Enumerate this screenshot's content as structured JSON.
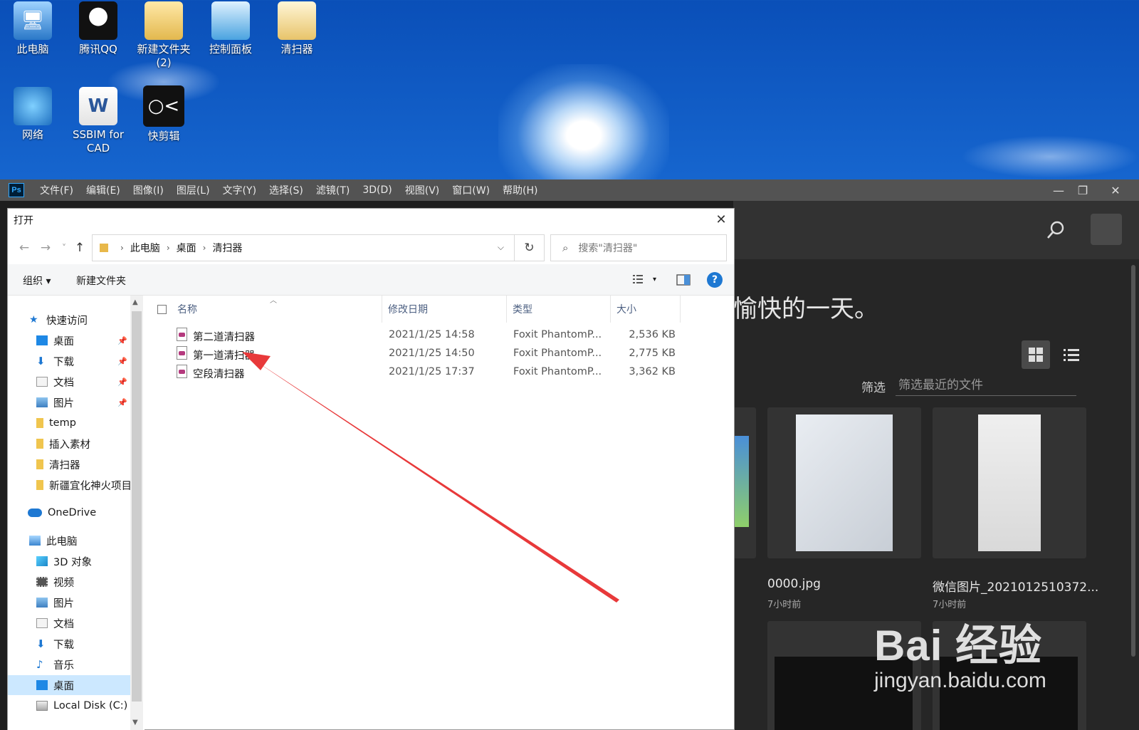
{
  "desktop": {
    "icons": [
      {
        "label": "此电脑",
        "icon": "computer-icon"
      },
      {
        "label": "腾讯QQ",
        "icon": "qq-icon"
      },
      {
        "label": "新建文件夹\n(2)",
        "icon": "folder-icon"
      },
      {
        "label": "控制面板",
        "icon": "control-panel-icon"
      },
      {
        "label": "清扫器",
        "icon": "folder-icon"
      },
      {
        "label": "网络",
        "icon": "network-icon"
      },
      {
        "label": "SSBIM for\nCAD",
        "icon": "word-document-icon"
      },
      {
        "label": "快剪辑",
        "icon": "kuaijianji-app-icon"
      }
    ]
  },
  "photoshop": {
    "logo": "Ps",
    "menus": [
      "文件(F)",
      "编辑(E)",
      "图像(I)",
      "图层(L)",
      "文字(Y)",
      "选择(S)",
      "滤镜(T)",
      "3D(D)",
      "视图(V)",
      "窗口(W)",
      "帮助(H)"
    ],
    "window_controls": {
      "minimize": "—",
      "restore": "❐",
      "close": "✕"
    },
    "home": {
      "greeting": "愉快的一天。",
      "filter_label": "筛选",
      "filter_placeholder": "筛选最近的文件",
      "recent_files": [
        {
          "name": "0000.jpg",
          "time": "7小时前"
        },
        {
          "name": "微信图片_2021012510372...",
          "time": "7小时前"
        }
      ]
    },
    "watermark": {
      "line1": "Bai 经验",
      "line2": "jingyan.baidu.com"
    }
  },
  "dialog": {
    "title": "打开",
    "close": "✕",
    "nav": {
      "back": "←",
      "forward": "→",
      "recent": "˅",
      "up": "↑"
    },
    "breadcrumb": [
      "此电脑",
      "桌面",
      "清扫器"
    ],
    "refresh": "↻",
    "search_placeholder": "搜索\"清扫器\"",
    "toolbar": {
      "organize": "组织 ▾",
      "new_folder": "新建文件夹",
      "help": "?"
    },
    "nav_pane": [
      {
        "label": "快速访问",
        "icon": "star-icon",
        "pinned": false
      },
      {
        "label": "桌面",
        "icon": "desktop-icon",
        "pinned": true
      },
      {
        "label": "下载",
        "icon": "download-icon",
        "pinned": true
      },
      {
        "label": "文档",
        "icon": "document-icon",
        "pinned": true
      },
      {
        "label": "图片",
        "icon": "pictures-icon",
        "pinned": true
      },
      {
        "label": "temp",
        "icon": "folder-icon",
        "pinned": false
      },
      {
        "label": "插入素材",
        "icon": "folder-icon",
        "pinned": false
      },
      {
        "label": "清扫器",
        "icon": "folder-icon",
        "pinned": false
      },
      {
        "label": "新疆宜化神火项目",
        "icon": "folder-icon",
        "pinned": false
      },
      {
        "label": "OneDrive",
        "icon": "onedrive-icon",
        "pinned": false
      },
      {
        "label": "此电脑",
        "icon": "computer-icon",
        "pinned": false
      },
      {
        "label": "3D 对象",
        "icon": "3d-objects-icon",
        "pinned": false
      },
      {
        "label": "视频",
        "icon": "video-icon",
        "pinned": false
      },
      {
        "label": "图片",
        "icon": "pictures-icon",
        "pinned": false
      },
      {
        "label": "文档",
        "icon": "document-icon",
        "pinned": false
      },
      {
        "label": "下载",
        "icon": "download-icon",
        "pinned": false
      },
      {
        "label": "音乐",
        "icon": "music-icon",
        "pinned": false
      },
      {
        "label": "桌面",
        "icon": "desktop-icon",
        "pinned": false,
        "selected": true
      },
      {
        "label": "Local Disk (C:)",
        "icon": "disk-icon",
        "pinned": false
      }
    ],
    "columns": {
      "name": "名称",
      "modified": "修改日期",
      "type": "类型",
      "size": "大小"
    },
    "files": [
      {
        "name": "第二道清扫器",
        "modified": "2021/1/25 14:58",
        "type": "Foxit PhantomP...",
        "size": "2,536 KB"
      },
      {
        "name": "第一道清扫器",
        "modified": "2021/1/25 14:50",
        "type": "Foxit PhantomP...",
        "size": "2,775 KB"
      },
      {
        "name": "空段清扫器",
        "modified": "2021/1/25 17:37",
        "type": "Foxit PhantomP...",
        "size": "3,362 KB"
      }
    ]
  },
  "colors": {
    "ps_menubar": "#535353",
    "ps_bg": "#262626",
    "nav_selected": "#cce8ff",
    "annotation_arrow": "#e8393a",
    "help_blue": "#1e78d2"
  }
}
